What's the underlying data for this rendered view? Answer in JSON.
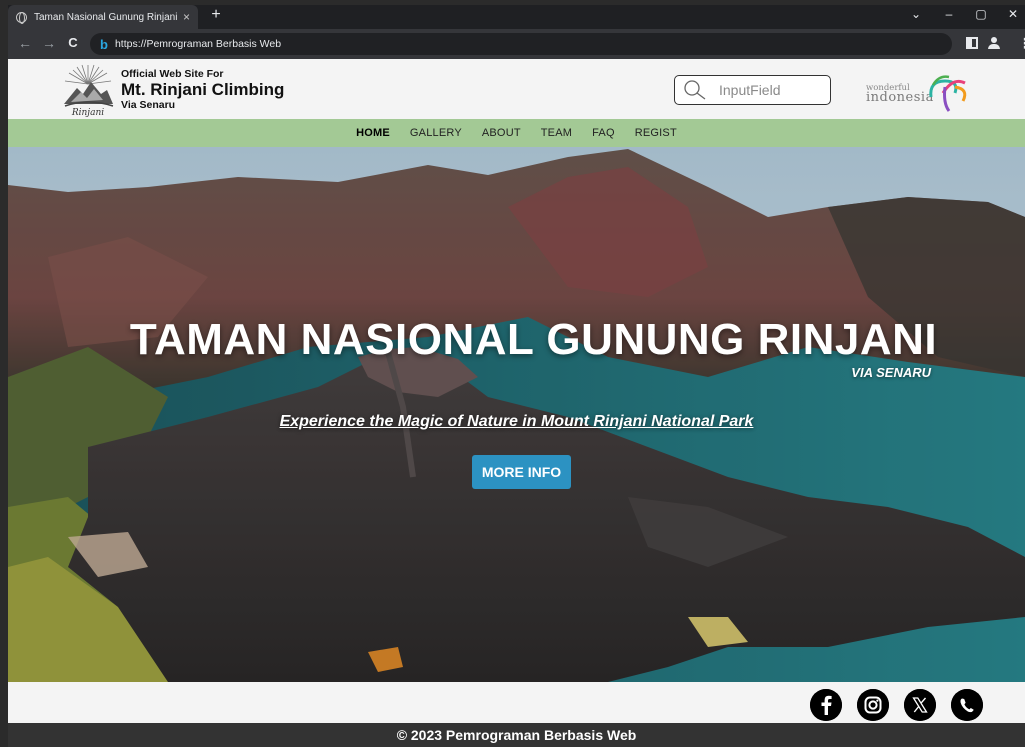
{
  "browser": {
    "tab_title": "Taman Nasional Gunung Rinjani",
    "tab_close": "×",
    "new_tab": "+",
    "url": "https://Pemrograman Berbasis Web",
    "window_controls": [
      "⌄",
      "–",
      "▢",
      "✕"
    ]
  },
  "header": {
    "logo_text": "Rinjani",
    "brand_line1": "Official Web Site For",
    "brand_line2": "Mt. Rinjani Climbing",
    "brand_line3": "Via Senaru",
    "search_placeholder": "InputField",
    "partner_logo_line1": "wonderful",
    "partner_logo_line2": "indonesia"
  },
  "nav": {
    "items": [
      {
        "label": "HOME",
        "active": true
      },
      {
        "label": "GALLERY",
        "active": false
      },
      {
        "label": "ABOUT",
        "active": false
      },
      {
        "label": "TEAM",
        "active": false
      },
      {
        "label": "FAQ",
        "active": false
      },
      {
        "label": "REGIST",
        "active": false
      }
    ]
  },
  "hero": {
    "title": "TAMAN NASIONAL GUNUNG RINJANI",
    "subtitle": "VIA SENARU",
    "tagline": "Experience the Magic of Nature in Mount Rinjani National Park",
    "button_label": "MORE INFO"
  },
  "social": {
    "icons": [
      "facebook-icon",
      "instagram-icon",
      "x-icon",
      "whatsapp-icon"
    ]
  },
  "footer": {
    "text": "© 2023 Pemrograman Berbasis Web"
  },
  "colors": {
    "nav_bg": "#a3c995",
    "button_bg": "#2c92c2",
    "footer_bg": "#333333"
  }
}
